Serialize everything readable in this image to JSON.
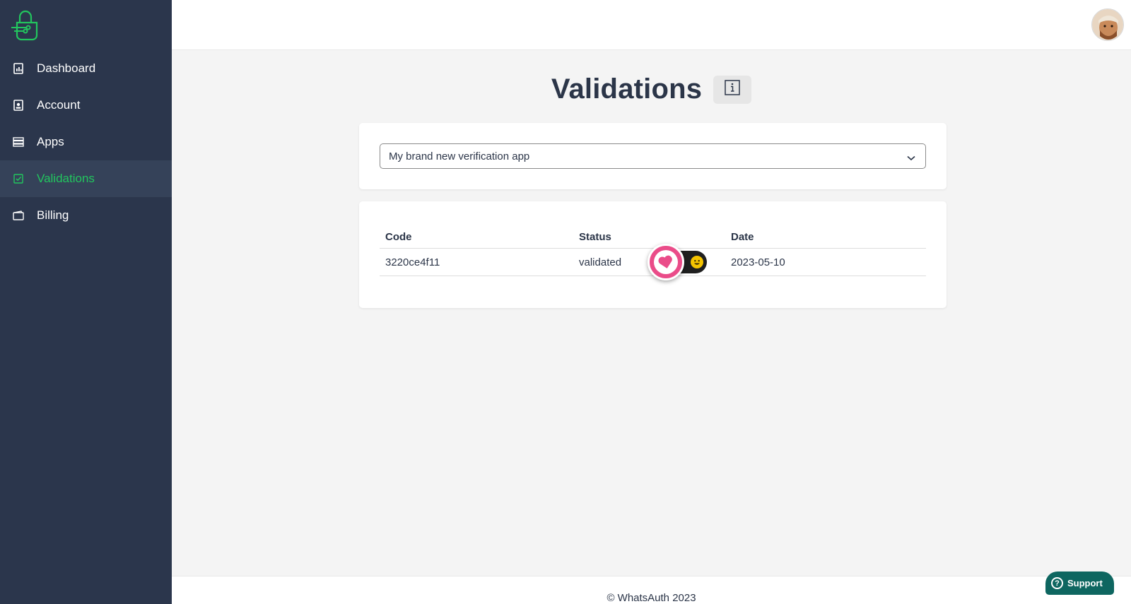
{
  "sidebar": {
    "items": [
      {
        "label": "Dashboard",
        "icon": "dashboard-icon"
      },
      {
        "label": "Account",
        "icon": "account-icon"
      },
      {
        "label": "Apps",
        "icon": "apps-icon"
      },
      {
        "label": "Validations",
        "icon": "validations-icon",
        "active": true
      },
      {
        "label": "Billing",
        "icon": "billing-icon"
      }
    ]
  },
  "page": {
    "title": "Validations",
    "info_icon": "info-icon"
  },
  "app_select": {
    "selected": "My brand new verification app"
  },
  "table": {
    "headers": {
      "code": "Code",
      "status": "Status",
      "date": "Date"
    },
    "rows": [
      {
        "code": "3220ce4f11",
        "status": "validated",
        "date": "2023-05-10"
      }
    ]
  },
  "overlay": {
    "reactions": [
      "heart-icon",
      "smiley-icon"
    ]
  },
  "footer": {
    "text": "© WhatsAuth 2023"
  },
  "support": {
    "label": "Support"
  },
  "colors": {
    "sidebar_bg": "#2b364c",
    "accent_green": "#22c55e",
    "support_bg": "#0e6660",
    "heart_pink": "#ea4c89"
  }
}
